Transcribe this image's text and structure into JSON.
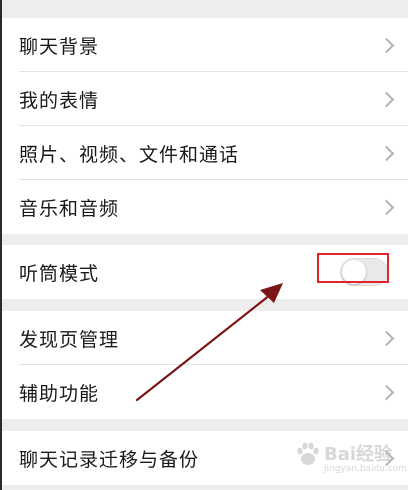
{
  "settings_group_1": [
    {
      "label": "聊天背景"
    },
    {
      "label": "我的表情"
    },
    {
      "label": "照片、视频、文件和通话"
    },
    {
      "label": "音乐和音频"
    }
  ],
  "settings_group_2": [
    {
      "label": "听筒模式",
      "toggle_on": false
    }
  ],
  "settings_group_3": [
    {
      "label": "发现页管理"
    },
    {
      "label": "辅助功能"
    }
  ],
  "settings_group_4": [
    {
      "label": "聊天记录迁移与备份"
    }
  ],
  "icons": {
    "row_chevron": "chevron-right-icon",
    "annotation_arrow": "arrow-icon"
  },
  "colors": {
    "background": "#ededed",
    "row_background": "#ffffff",
    "highlight_box": "#e0252b",
    "arrow": "#7a1515",
    "toggle_off": "#e9e9e9"
  },
  "watermark": {
    "brand": "Bai经验",
    "url": "jingyan.baidu.com"
  }
}
